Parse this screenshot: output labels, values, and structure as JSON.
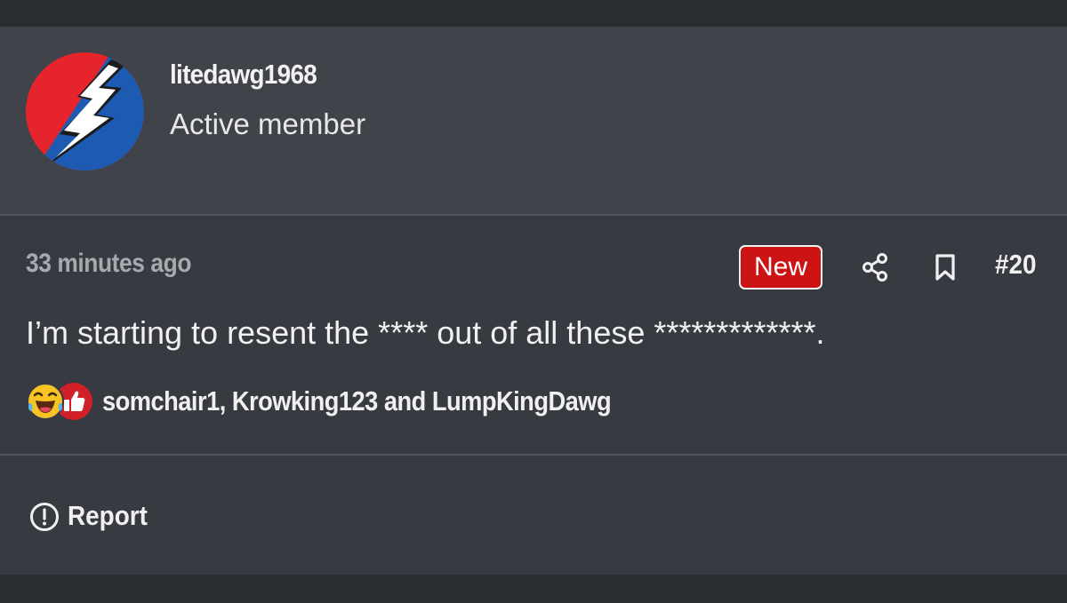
{
  "post": {
    "author": {
      "username": "litedawg1968",
      "title": "Active member",
      "avatar": "steal-your-face-lightning-bolt"
    },
    "timestamp": "33 minutes ago",
    "badge": "New",
    "actions": {
      "share_icon": "share-icon",
      "bookmark_icon": "bookmark-icon"
    },
    "number": "#20",
    "body": "I’m starting to resent the **** out of all these *************.",
    "reactions": {
      "icons": [
        "laughing-emoji-icon",
        "thumbs-up-icon"
      ],
      "users": "somchair1, Krowking123 and LumpKingDawg"
    },
    "report_label": "Report"
  },
  "colors": {
    "card": "#373a40",
    "header": "#40434a",
    "badge": "#cc1414",
    "muted_text": "#a6a9ae"
  }
}
